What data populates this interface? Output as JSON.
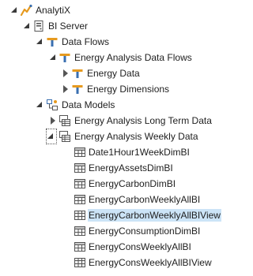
{
  "tree": {
    "root": {
      "label": "AnalytiX",
      "icon": "analytix-icon"
    },
    "server": {
      "label": "BI Server",
      "icon": "server-icon"
    },
    "data_flows": {
      "label": "Data Flows",
      "icon": "flow-icon"
    },
    "energy_analysis_data_flows": {
      "label": "Energy Analysis Data Flows",
      "icon": "flow-icon"
    },
    "energy_data": {
      "label": "Energy Data",
      "icon": "flow-icon"
    },
    "energy_dimensions": {
      "label": "Energy Dimensions",
      "icon": "flow-icon"
    },
    "data_models": {
      "label": "Data Models",
      "icon": "data-model-icon"
    },
    "long_term_data": {
      "label": "Energy Analysis Long Term Data",
      "icon": "model-icon"
    },
    "weekly_data": {
      "label": "Energy Analysis Weekly Data",
      "icon": "model-icon"
    },
    "tables": [
      {
        "label": "Date1Hour1WeekDimBI",
        "icon": "table-icon"
      },
      {
        "label": "EnergyAssetsDimBI",
        "icon": "table-icon"
      },
      {
        "label": "EnergyCarbonDimBI",
        "icon": "table-icon"
      },
      {
        "label": "EnergyCarbonWeeklyAllBI",
        "icon": "table-icon"
      },
      {
        "label": "EnergyCarbonWeeklyAllBIView",
        "icon": "view-icon",
        "selected": true
      },
      {
        "label": "EnergyConsumptionDimBI",
        "icon": "table-icon"
      },
      {
        "label": "EnergyConsWeeklyAllBI",
        "icon": "table-icon"
      },
      {
        "label": "EnergyConsWeeklyAllBIView",
        "icon": "view-icon"
      }
    ]
  }
}
